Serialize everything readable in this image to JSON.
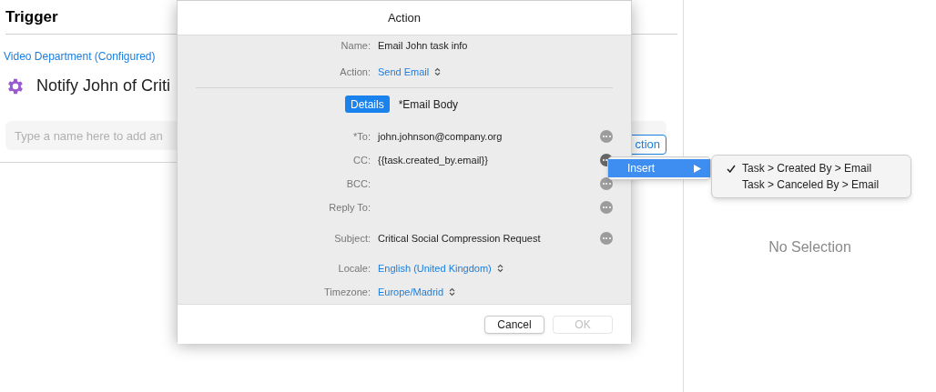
{
  "background": {
    "title": "Trigger",
    "link": "Video Department (Configured)",
    "item": "Notify John of Criti",
    "search": {
      "placeholder": "Type a name here to add an"
    },
    "button": "ction",
    "detail": "No Selection"
  },
  "dialog": {
    "title": "Action",
    "fields": [
      {
        "label": "Name:",
        "value": "Email John task info",
        "kind": "text"
      },
      {
        "label": "Action:",
        "value": "Send Email",
        "kind": "popup"
      }
    ],
    "tabs": [
      {
        "label": "Details",
        "selected": true
      },
      {
        "label": "*Email Body",
        "selected": false
      }
    ],
    "email_fields": [
      {
        "label": "*To:",
        "value": "john.johnson@company.org",
        "active": false
      },
      {
        "label": "CC:",
        "value": "{{task.created_by.email}}",
        "active": true
      },
      {
        "label": "BCC:",
        "active": false
      },
      {
        "label": "Reply To:",
        "active": false
      },
      {
        "label": "Subject:",
        "value": "Critical Social Compression Request",
        "active": false
      }
    ],
    "settings": [
      {
        "label": "Locale:",
        "value": "English (United Kingdom)",
        "kind": "popup"
      },
      {
        "label": "Timezone:",
        "value": "Europe/Madrid",
        "kind": "popup"
      }
    ],
    "buttons": [
      {
        "label": "Cancel",
        "disabled": false
      },
      {
        "label": "OK",
        "disabled": true
      }
    ]
  },
  "menu": {
    "items": [
      {
        "label": "Insert",
        "selected": true
      }
    ]
  },
  "submenu": {
    "items": [
      {
        "label": "Task > Created By > Email",
        "checked": true
      },
      {
        "label": "Task > Canceled By > Email",
        "checked": false
      }
    ]
  }
}
